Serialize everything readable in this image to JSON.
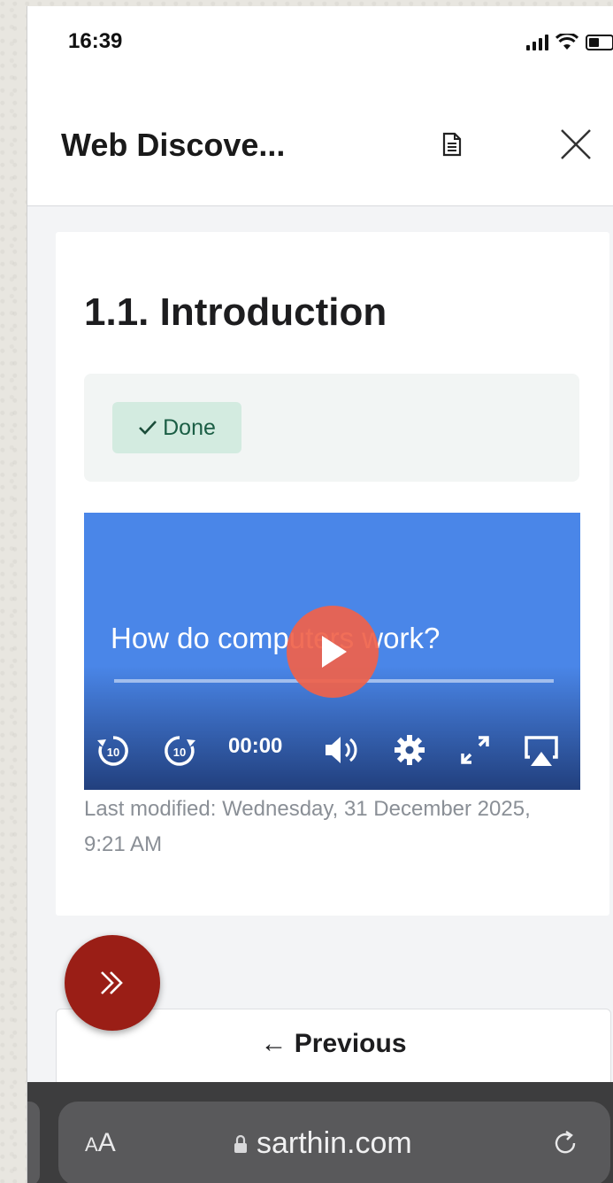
{
  "status_bar": {
    "time": "16:39"
  },
  "header": {
    "title": "Web Discove...",
    "doc_icon": "document-icon",
    "close_icon": "close-icon"
  },
  "content": {
    "section_title": "1.1. Introduction",
    "completion": {
      "label": "Done",
      "icon": "checkmark-icon"
    },
    "video": {
      "title": "How do computers work?",
      "time": "00:00",
      "progress": 0,
      "accent_color": "#4a86e8",
      "play_button_color": "#f0624a"
    },
    "last_modified": "Last modified: Wednesday, 31 December 2025, 9:21 AM"
  },
  "fab": {
    "icon": "double-chevron-right-icon",
    "color": "#9a1e16"
  },
  "navigation": {
    "previous_label": "Previous",
    "previous_icon": "arrow-left-icon"
  },
  "browser": {
    "text_size_label_small": "A",
    "text_size_label_large": "A",
    "url": "sarthin.com"
  }
}
